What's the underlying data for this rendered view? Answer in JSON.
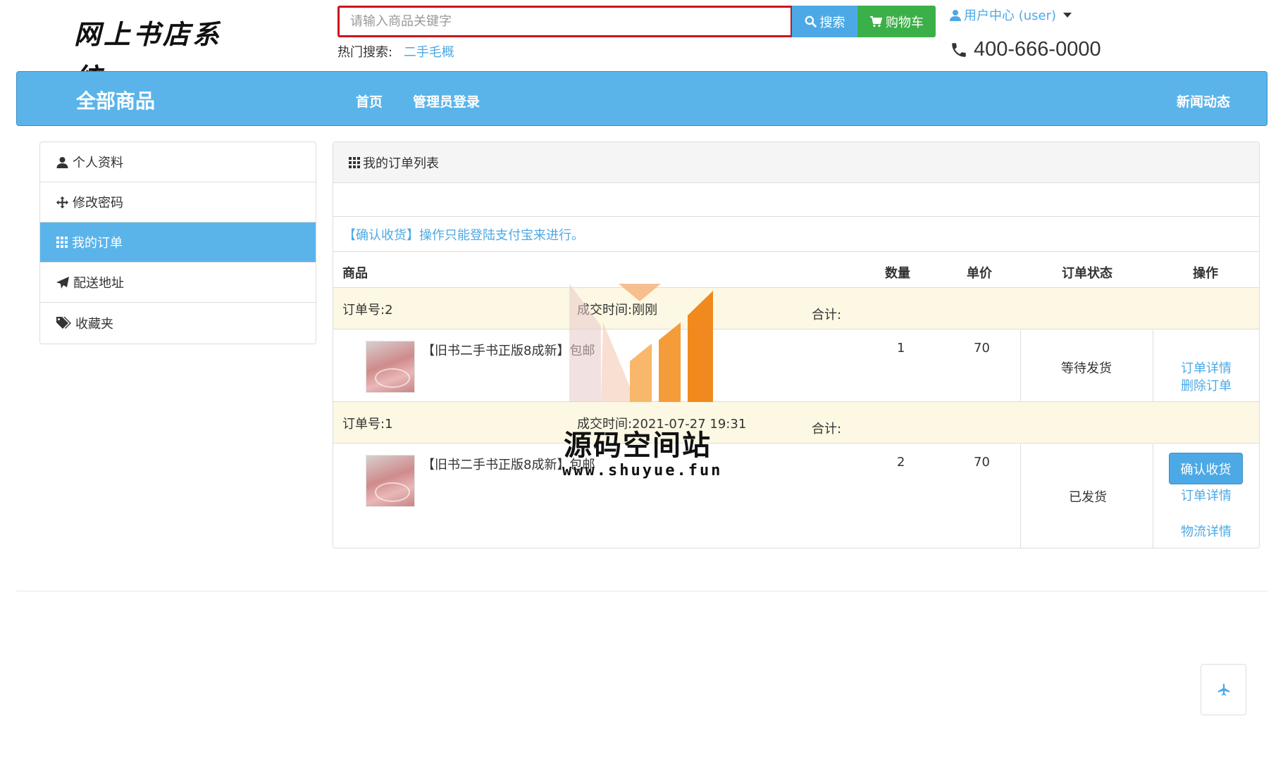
{
  "header": {
    "logo_text": "网上书店系统",
    "search_placeholder": "请输入商品关键字",
    "search_label": "搜索",
    "cart_label": "购物车",
    "hot_label": "热门搜索:",
    "hot_keyword": "二手毛概",
    "user_center": "用户中心 (user)",
    "phone": "400-666-0000"
  },
  "nav": {
    "brand": "全部商品",
    "items": [
      "首页",
      "管理员登录"
    ],
    "news": "新闻动态"
  },
  "sidebar": {
    "items": [
      {
        "label": "个人资料",
        "icon": "user-icon"
      },
      {
        "label": "修改密码",
        "icon": "move-icon"
      },
      {
        "label": "我的订单",
        "icon": "grid-icon",
        "active": true
      },
      {
        "label": "配送地址",
        "icon": "send-icon"
      },
      {
        "label": "收藏夹",
        "icon": "tags-icon"
      }
    ]
  },
  "orders_panel": {
    "title": "我的订单列表",
    "notice": "【确认收货】操作只能登陆支付宝来进行。",
    "columns": [
      "商品",
      "数量",
      "单价",
      "订单状态",
      "操作"
    ],
    "orders": [
      {
        "order_no": "订单号:2",
        "deal_time": "成交时间:刚刚",
        "total": "合计:",
        "product": "【旧书二手书正版8成新】包邮",
        "quantity": "1",
        "price": "70",
        "status": "等待发货",
        "actions": [
          "订单详情",
          "删除订单"
        ]
      },
      {
        "order_no": "订单号:1",
        "deal_time": "成交时间:2021-07-27 19:31",
        "total": "合计:",
        "product": "【旧书二手书正版8成新】包邮",
        "quantity": "2",
        "price": "70",
        "status": "已发货",
        "confirm_label": "确认收货",
        "actions": [
          "订单详情",
          "物流详情"
        ]
      }
    ]
  },
  "watermark": {
    "title": "源码空间站",
    "url": "www.shuyue.fun"
  },
  "colors": {
    "primary": "#5ab4ea",
    "link": "#4da9e5",
    "cart": "#3cb048",
    "search_border": "#c9151e",
    "order_row_bg": "#fcf8e3"
  }
}
